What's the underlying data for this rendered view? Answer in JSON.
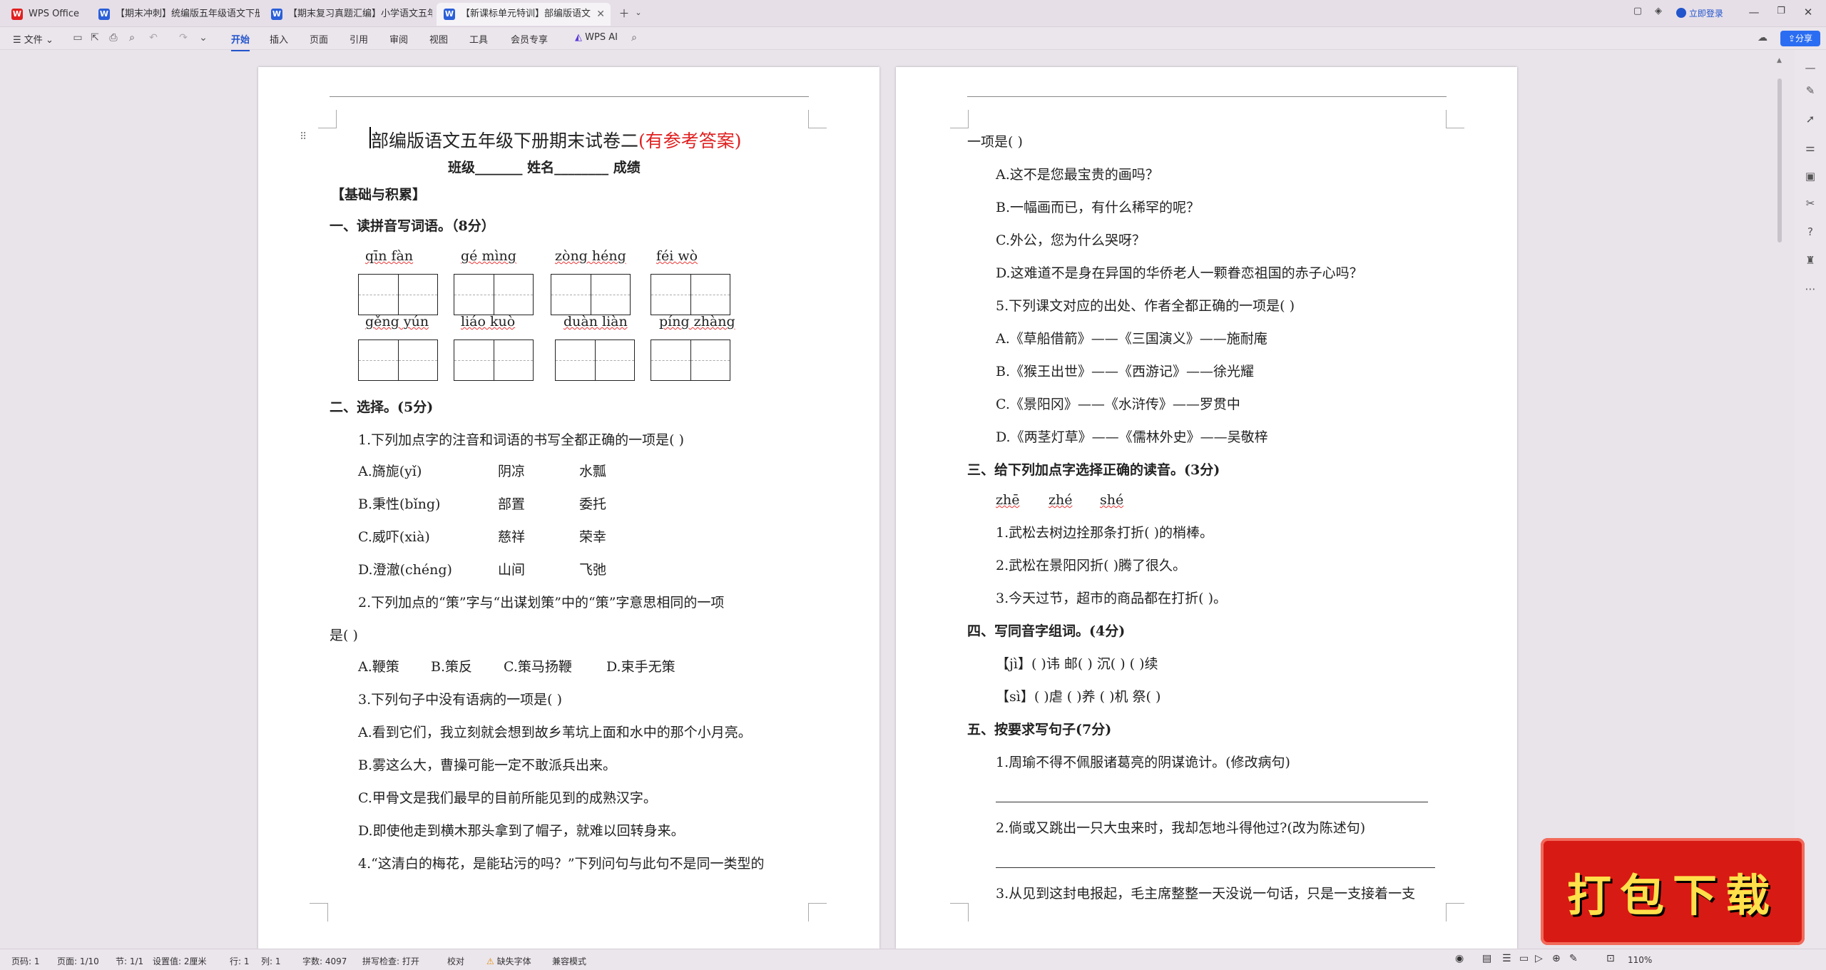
{
  "tabs": [
    {
      "label": "WPS Office",
      "type": "wps"
    },
    {
      "label": "【期末冲刺】统编版五年级语文下册",
      "type": "doc"
    },
    {
      "label": "【期末复习真题汇编】小学语文五年级",
      "type": "doc"
    },
    {
      "label": "【新课标单元特训】部编版语文",
      "type": "doc"
    }
  ],
  "titlebar": {
    "login": "立即登录"
  },
  "menus": [
    "开始",
    "插入",
    "页面",
    "引用",
    "审阅",
    "视图",
    "工具",
    "会员专享"
  ],
  "file_menu": "文件",
  "wps_ai": "WPS AI",
  "share": "分享",
  "status": {
    "page": "页码: 1",
    "pages": "页面: 1/10",
    "section": "节: 1/1",
    "setting": "设置值: 2厘米",
    "row": "行: 1",
    "col": "列: 1",
    "words": "字数: 4097",
    "spell": "拼写检查: 打开",
    "proof": "校对",
    "font": "缺失字体",
    "compat": "兼容模式",
    "zoom": "110%"
  },
  "stamp": "打包下载",
  "page1": {
    "title": "部编版语文五年级下册期末试卷二",
    "title_red": "(有参考答案)",
    "info": "班级_______   姓名________   成绩",
    "section0": "【基础与积累】",
    "q1": "一、读拼音写词语。（8分）",
    "pinyin_row1": [
      "qīn fàn",
      "gé mìng",
      "zòng héng",
      "féi   wò"
    ],
    "pinyin_row2": [
      "gěng yún",
      "liáo kuò",
      "duàn liàn",
      "píng zhàng"
    ],
    "q2": "二、选择。(5分)",
    "q2_1": "1.下列加点字的注音和词语的书写全都正确的一项是(     )",
    "q2_1_opts": [
      [
        "A.旖旎(yǐ)",
        "阴凉",
        "水瓢"
      ],
      [
        "B.秉性(bǐng)",
        "部置",
        "委托"
      ],
      [
        "C.威吓(xià)",
        "慈祥",
        "荣幸"
      ],
      [
        "D.澄澈(chéng)",
        "山间",
        "飞弛"
      ]
    ],
    "q2_2a": "2.下列加点的“策”字与“出谋划策”中的“策”字意思相同的一项",
    "q2_2b": "是(     )",
    "q2_2_opts": [
      "A.鞭策",
      "B.策反",
      "C.策马扬鞭",
      "D.束手无策"
    ],
    "q2_3": "3.下列句子中没有语病的一项是(     )",
    "q2_3_opts": [
      "A.看到它们，我立刻就会想到故乡苇坑上面和水中的那个小月亮。",
      "B.雾这么大，曹操可能一定不敢派兵出来。",
      "C.甲骨文是我们最早的目前所能见到的成熟汉字。",
      "D.即使他走到横木那头拿到了帽子，就难以回转身来。"
    ],
    "q2_4": "4.“这清白的梅花，是能玷污的吗？”下列问句与此句不是同一类型的"
  },
  "page2": {
    "l1": "一项是(     )",
    "opts1": [
      "A.这不是您最宝贵的画吗？",
      "B.一幅画而已，有什么稀罕的呢？",
      "C.外公，您为什么哭呀？",
      "D.这难道不是身在异国的华侨老人一颗眷恋祖国的赤子心吗？"
    ],
    "q5": "5.下列课文对应的出处、作者全都正确的一项是(     )",
    "opts5": [
      "A.《草船借箭》——《三国演义》——施耐庵",
      "B.《猴王出世》——《西游记》——徐光耀",
      "C.《景阳冈》——《水浒传》——罗贯中",
      "D.《两茎灯草》——《儒林外史》——吴敬梓"
    ],
    "q3": "三、给下列加点字选择正确的读音。(3分)",
    "q3_py": [
      "zhē",
      "zhé",
      "shé"
    ],
    "q3_items": [
      "1.武松去树边拴那条打折(        )的梢棒。",
      "2.武松在景阳冈折(        )腾了很久。",
      "3.今天过节，超市的商品都在打折(        )。"
    ],
    "q4": "四、写同音字组词。(4分)",
    "q4_l1": "【jì】(      )讳      邮(      )      沉(      )      (      )续",
    "q4_l2": "【sì】(      )虐      (      )养      (      )机      祭(      )",
    "q5h": "五、按要求写句子(7分)",
    "s1": "1.周瑜不得不佩服诸葛亮的阴谋诡计。(修改病句)",
    "s2": "2.倘或又跳出一只大虫来时，我却怎地斗得他过?(改为陈述句)",
    "s3": "3.从见到这封电报起，毛主席整整一天没说一句话，只是一支接着一支"
  }
}
